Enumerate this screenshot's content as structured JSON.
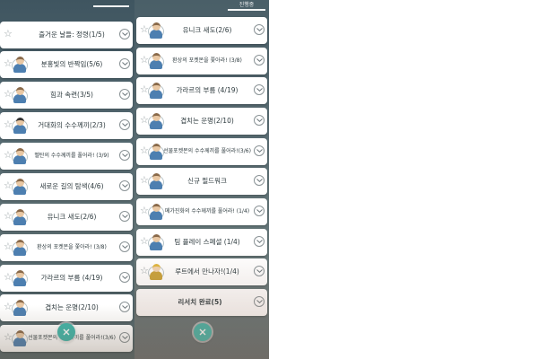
{
  "left_panel": {
    "tabs": [
      "",
      "",
      ""
    ],
    "items": [
      {
        "label": "즐거운 날들: 정령(1/5)",
        "avatar": "none"
      },
      {
        "label": "분홍빛의 반짝임(5/6)",
        "avatar": "professor"
      },
      {
        "label": "힘과 속련(3/5)",
        "avatar": "professor"
      },
      {
        "label": "거대화의 수수께끼(2/3)",
        "avatar": "professor-dark"
      },
      {
        "label": "멜탄의 수수께끼를 풀어라! (3/9)",
        "avatar": "professor"
      },
      {
        "label": "새로운 길의 탐색(4/6)",
        "avatar": "professor"
      },
      {
        "label": "유니크 새도(2/6)",
        "avatar": "professor"
      },
      {
        "label": "환상의 포켓몬을 쫓아라! (3/8)",
        "avatar": "professor"
      },
      {
        "label": "가라르의 부름 (4/19)",
        "avatar": "professor"
      },
      {
        "label": "겹치는 운명(2/10)",
        "avatar": "professor"
      },
      {
        "label": "선물포켓몬의 수수께끼를 풀어라!(3/6)",
        "avatar": "professor"
      }
    ]
  },
  "right_panel": {
    "tabs": [
      "",
      "",
      "진행중"
    ],
    "items": [
      {
        "label": "유니크 새도(2/6)",
        "avatar": "professor"
      },
      {
        "label": "환상의 포켓몬을 쫓아라! (3/8)",
        "avatar": "professor"
      },
      {
        "label": "가라르의 부름 (4/19)",
        "avatar": "professor"
      },
      {
        "label": "겹치는 운명(2/10)",
        "avatar": "professor"
      },
      {
        "label": "선물포켓몬의 수수께끼를 풀어라!(3/6)",
        "avatar": "professor"
      },
      {
        "label": "신규 필드워크",
        "avatar": "professor"
      },
      {
        "label": "메가진화의 수수께끼를 풀어라! (1/4)",
        "avatar": "professor"
      },
      {
        "label": "팀 플레이 스페셜 (1/4)",
        "avatar": "professor"
      },
      {
        "label": "루트에서 만나자!(1/4)",
        "avatar": "blond"
      },
      {
        "label": "리서치 완료(5)",
        "avatar": "none"
      }
    ]
  },
  "icons": {
    "star": "star-outline-icon",
    "expand": "chevron-down-icon",
    "close": "close-icon"
  },
  "colors": {
    "accent": "#3fb6aa",
    "card": "#ffffff",
    "text": "#2d3a3e"
  }
}
